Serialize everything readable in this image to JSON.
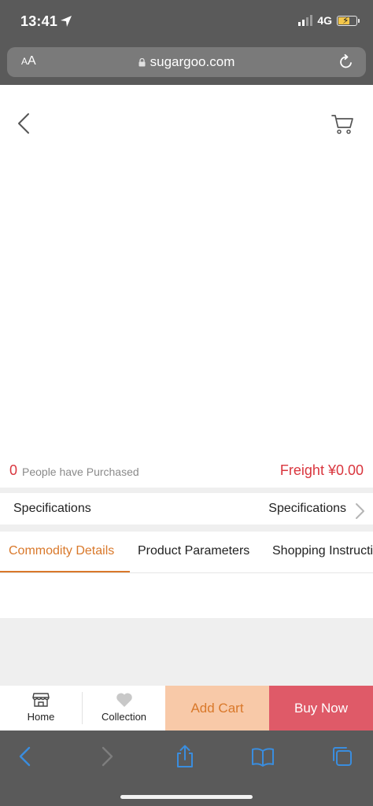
{
  "status_bar": {
    "time": "13:41",
    "network": "4G"
  },
  "browser": {
    "text_size_label_small": "A",
    "text_size_label_large": "A",
    "url": "sugargoo.com"
  },
  "product": {
    "purchase_count": "0",
    "purchase_label": "People have Purchased",
    "freight": "Freight ¥0.00"
  },
  "specifications": {
    "label": "Specifications",
    "value": "Specifications"
  },
  "tabs": [
    {
      "label": "Commodity Details",
      "active": true
    },
    {
      "label": "Product Parameters",
      "active": false
    },
    {
      "label": "Shopping Instructions",
      "active": false
    }
  ],
  "action_bar": {
    "home_label": "Home",
    "collection_label": "Collection",
    "add_cart_label": "Add Cart",
    "buy_now_label": "Buy Now"
  },
  "colors": {
    "accent_orange": "#d9782a",
    "price_red": "#d9363e",
    "buy_now_bg": "#df5a68",
    "add_cart_bg": "#f8c9a8",
    "safari_chrome": "#5a5a5a",
    "toolbar_blue": "#3a8dde"
  },
  "icons": {
    "status_location": "location-arrow-icon",
    "status_signal": "cellular-signal-icon",
    "status_battery": "battery-charging-icon",
    "url_lock": "lock-icon",
    "url_reload": "reload-icon",
    "page_back": "back-chevron-icon",
    "page_cart": "cart-icon",
    "spec_more": "chevron-right-icon",
    "home": "store-icon",
    "collection": "heart-icon",
    "toolbar_back": "back-arrow-icon",
    "toolbar_forward": "forward-arrow-icon",
    "toolbar_share": "share-icon",
    "toolbar_bookmarks": "bookmarks-icon",
    "toolbar_tabs": "tabs-icon"
  }
}
